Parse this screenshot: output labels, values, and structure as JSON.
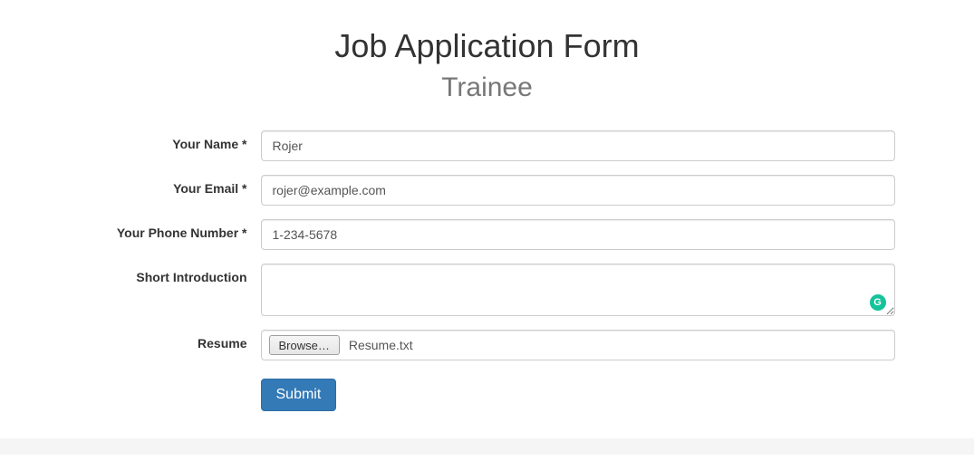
{
  "header": {
    "title": "Job Application Form",
    "subtitle": "Trainee"
  },
  "form": {
    "name": {
      "label": "Your Name *",
      "value": "Rojer"
    },
    "email": {
      "label": "Your Email *",
      "value": "rojer@example.com"
    },
    "phone": {
      "label": "Your Phone Number *",
      "value": "1-234-5678"
    },
    "intro": {
      "label": "Short Introduction",
      "value": ""
    },
    "resume": {
      "label": "Resume",
      "browse_label": "Browse…",
      "file_name": "Resume.txt"
    },
    "submit_label": "Submit"
  },
  "badges": {
    "grammarly": "G"
  }
}
